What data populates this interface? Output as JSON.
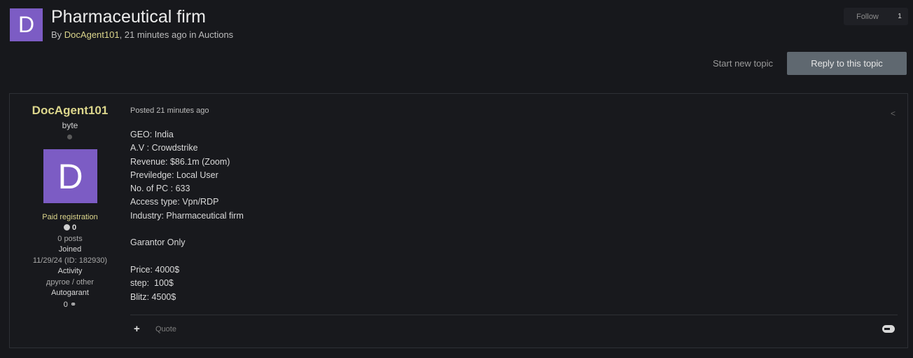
{
  "topic": {
    "avatar_letter": "D",
    "title": "Pharmaceutical firm",
    "by_prefix": "By ",
    "author": "DocAgent101",
    "meta_suffix": ", 21 minutes ago in Auctions"
  },
  "follow": {
    "label": "Follow",
    "count": "1"
  },
  "actions": {
    "start_new_topic": "Start new topic",
    "reply": "Reply to this topic"
  },
  "post": {
    "author": {
      "name": "DocAgent101",
      "rank": "byte",
      "avatar_letter": "D",
      "group": "Paid registration",
      "reputation": "0",
      "posts": "0 posts",
      "joined_label": "Joined",
      "joined_value": "11/29/24 (ID: 182930)",
      "activity_label": "Activity",
      "activity_value": "другое / other",
      "autogarant_label": "Autogarant",
      "autogarant_value": "0"
    },
    "posted": "Posted 21 minutes ago",
    "lines": [
      "GEO: India",
      "A.V : Crowdstrike",
      "Revenue: $86.1m (Zoom)",
      "Previledge: Local User",
      "No. of PC : 633",
      "Access type: Vpn/RDP",
      "Industry: Pharmaceutical firm",
      "",
      "Garantor Only",
      "",
      "Price: 4000$",
      "step:  100$",
      "Blitz: 4500$"
    ],
    "quote_label": "Quote"
  },
  "colors": {
    "accent": "#dcd68c",
    "avatar": "#7c5cc4",
    "reply_button": "#5f6870",
    "background": "#17181c"
  }
}
